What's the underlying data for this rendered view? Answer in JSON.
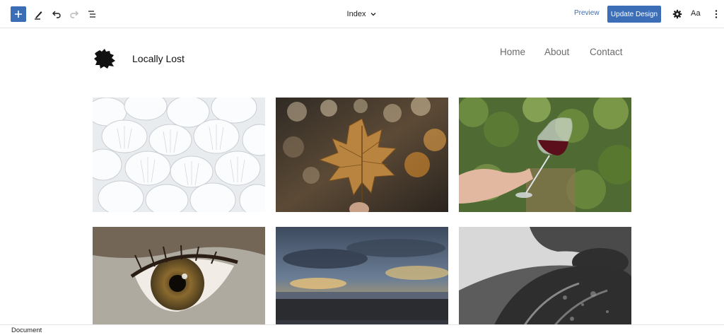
{
  "toolbar": {
    "add_icon": "plus-icon",
    "tools_icon": "pencil-icon",
    "undo_icon": "undo-icon",
    "redo_icon": "redo-icon",
    "list_view_icon": "list-view-icon",
    "document_title": "Index",
    "preview_label": "Preview",
    "update_label": "Update Design",
    "settings_icon": "gear-icon",
    "styles_label": "Aa",
    "more_icon": "more-vertical-icon",
    "accent_color": "#3c6db7"
  },
  "site": {
    "title": "Locally Lost",
    "nav": [
      "Home",
      "About",
      "Contact"
    ]
  },
  "gallery": [
    {
      "subject": "seashells"
    },
    {
      "subject": "autumn-leaf"
    },
    {
      "subject": "wine-glass-vineyard"
    },
    {
      "subject": "eye"
    },
    {
      "subject": "sunset-sea"
    },
    {
      "subject": "wine-barrels"
    }
  ],
  "footer": {
    "breadcrumb": "Document"
  }
}
